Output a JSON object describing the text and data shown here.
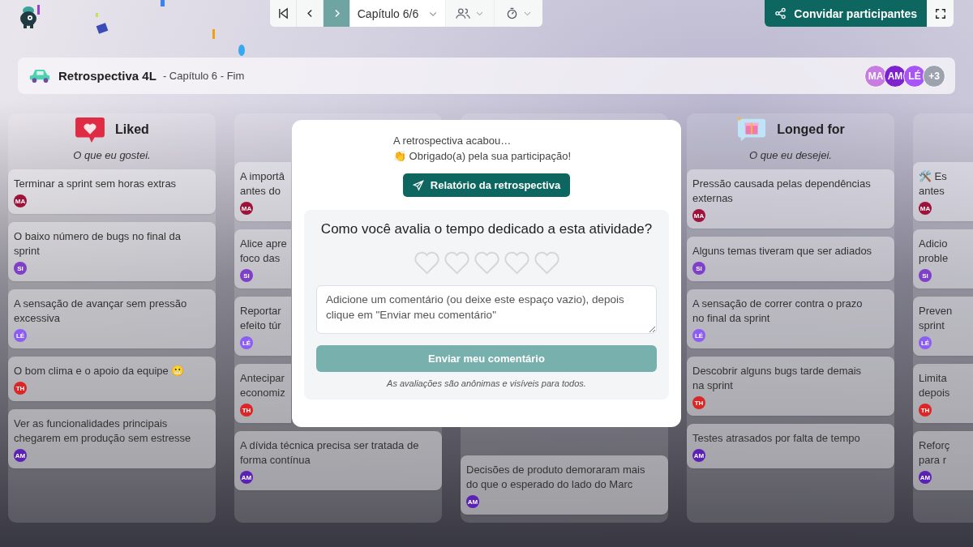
{
  "toolbar": {
    "nav": [
      {
        "kind": "first",
        "highlighted": false
      },
      {
        "kind": "prev",
        "highlighted": false
      },
      {
        "kind": "next",
        "highlighted": true
      }
    ],
    "chapter": "Capítulo 6/6",
    "dropdowns": [
      {
        "kind": "participants"
      },
      {
        "kind": "timer"
      }
    ],
    "invite_button": "Convidar participantes"
  },
  "board_header": {
    "title": "Retrospectiva 4L",
    "subtitle": "- Capítulo 6 - Fim",
    "participants": [
      {
        "initials": "MA",
        "color": "#c77ddf"
      },
      {
        "initials": "AM",
        "color": "#7e22ce"
      },
      {
        "initials": "LÉ",
        "color": "#a855f7"
      }
    ],
    "more": "+3"
  },
  "columns": [
    {
      "kind": "liked",
      "title": "Liked",
      "subtitle": "O que eu gostei.",
      "cards": [
        {
          "lines": [
            "Terminar a sprint sem horas extras"
          ],
          "author": {
            "initials": "MA",
            "color": "#9f1239"
          }
        },
        {
          "lines": [
            "O baixo número de bugs no final da",
            "sprint"
          ],
          "author": {
            "initials": "SI",
            "color": "#7e3fc9"
          }
        },
        {
          "lines": [
            "A sensação de avançar sem pressão",
            "excessiva"
          ],
          "author": {
            "initials": "LÉ",
            "color": "#8b5cf6"
          }
        },
        {
          "lines": [
            "O bom clima e o apoio da equipe 😬"
          ],
          "author": {
            "initials": "TH",
            "color": "#dc2626"
          }
        },
        {
          "lines": [
            "Ver as funcionalidades principais",
            "chegarem em produção sem estresse"
          ],
          "author": {
            "initials": "AM",
            "color": "#5b21b6"
          }
        }
      ]
    },
    {
      "kind": "partial",
      "cards": [
        {
          "lines": [
            "A importâ",
            "antes do"
          ],
          "author": {
            "initials": "MA",
            "color": "#9f1239"
          }
        },
        {
          "lines": [
            "Alice apre",
            "foco das"
          ],
          "author": {
            "initials": "SI",
            "color": "#7e3fc9"
          }
        },
        {
          "lines": [
            "Reportar",
            "efeito túr"
          ],
          "author": {
            "initials": "LÉ",
            "color": "#8b5cf6"
          }
        },
        {
          "lines": [
            "Antecipar",
            "economiz"
          ],
          "author": {
            "initials": "TH",
            "color": "#dc2626"
          }
        },
        {
          "lines": [
            "A dívida técnica precisa ser tratada de",
            "forma contínua"
          ],
          "author": {
            "initials": "AM",
            "color": "#5b21b6"
          }
        }
      ]
    },
    {
      "kind": "covered",
      "cards": [
        {
          "lines": [
            "Decisões de produto demoraram mais",
            "do que o esperado do lado do Marc"
          ],
          "author": {
            "initials": "AM",
            "color": "#5b21b6"
          }
        }
      ]
    },
    {
      "kind": "longed",
      "title": "Longed for",
      "subtitle": "O que eu desejei.",
      "cards": [
        {
          "lines": [
            "Pressão causada pelas dependências",
            "externas"
          ],
          "author": {
            "initials": "MA",
            "color": "#9f1239"
          }
        },
        {
          "lines": [
            "Alguns temas tiveram que ser adiados"
          ],
          "author": {
            "initials": "SI",
            "color": "#7e3fc9"
          }
        },
        {
          "lines": [
            "A sensação de correr contra o prazo",
            "no final da sprint"
          ],
          "author": {
            "initials": "LÉ",
            "color": "#8b5cf6"
          }
        },
        {
          "lines": [
            "Descobrir alguns bugs tarde demais",
            "na sprint"
          ],
          "author": {
            "initials": "TH",
            "color": "#dc2626"
          }
        },
        {
          "lines": [
            "Testes atrasados por falta de tempo"
          ],
          "author": {
            "initials": "AM",
            "color": "#5b21b6"
          }
        }
      ]
    },
    {
      "kind": "plain",
      "cards": [
        {
          "lines": [
            "🛠️ Es",
            "antes"
          ],
          "author": {
            "initials": "MA",
            "color": "#9f1239"
          }
        },
        {
          "lines": [
            "Adicio",
            "proble"
          ],
          "author": {
            "initials": "SI",
            "color": "#7e3fc9"
          }
        },
        {
          "lines": [
            "Preven",
            "sprint"
          ],
          "author": {
            "initials": "LÉ",
            "color": "#8b5cf6"
          }
        },
        {
          "lines": [
            "Limita",
            "depois"
          ],
          "author": {
            "initials": "TH",
            "color": "#dc2626"
          }
        },
        {
          "lines": [
            "Reforç",
            "para r"
          ],
          "author": {
            "initials": "AM",
            "color": "#5b21b6"
          }
        }
      ]
    }
  ],
  "modal": {
    "line_1": "A retrospectiva acabou…",
    "line_2": "👏 Obrigado(a) pela sua participação!",
    "report_button": "Relatório da retrospectiva",
    "question": "Como você avalia o tempo dedicado a esta atividade?",
    "stars": 0,
    "comment": {
      "placeholder": "Adicione um comentário (ou deixe este espaço vazio), depois clique em \"Enviar meu comentário\""
    },
    "submit_button": {
      "label": "Enviar meu comentário",
      "disabled": true
    },
    "note": "As avaliações são anônimas e visíveis para todos."
  }
}
